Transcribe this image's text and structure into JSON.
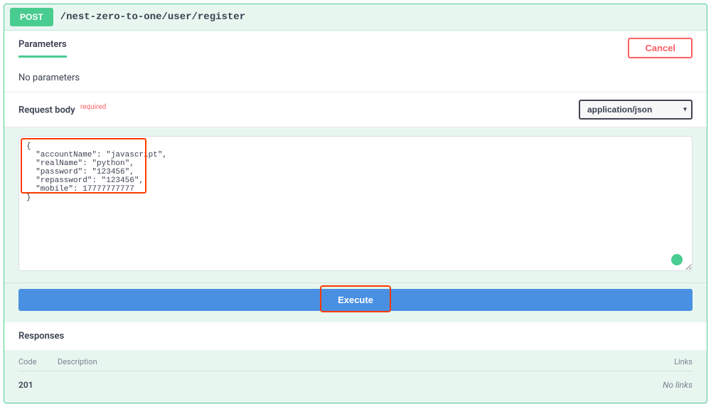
{
  "method": "POST",
  "path": "/nest-zero-to-one/user/register",
  "parameters": {
    "title": "Parameters",
    "cancel_label": "Cancel",
    "empty_text": "No parameters"
  },
  "request_body": {
    "label": "Request body",
    "required_tag": "required",
    "content_type": "application/json",
    "body_text": "{\n  \"accountName\": \"javascript\",\n  \"realName\": \"python\",\n  \"password\": \"123456\",\n  \"repassword\": \"123456\",\n  \"mobile\": 17777777777\n}"
  },
  "execute_label": "Execute",
  "responses": {
    "title": "Responses",
    "headers": {
      "code": "Code",
      "description": "Description",
      "links": "Links"
    },
    "rows": [
      {
        "code": "201",
        "description": "",
        "links": "No links"
      }
    ]
  }
}
